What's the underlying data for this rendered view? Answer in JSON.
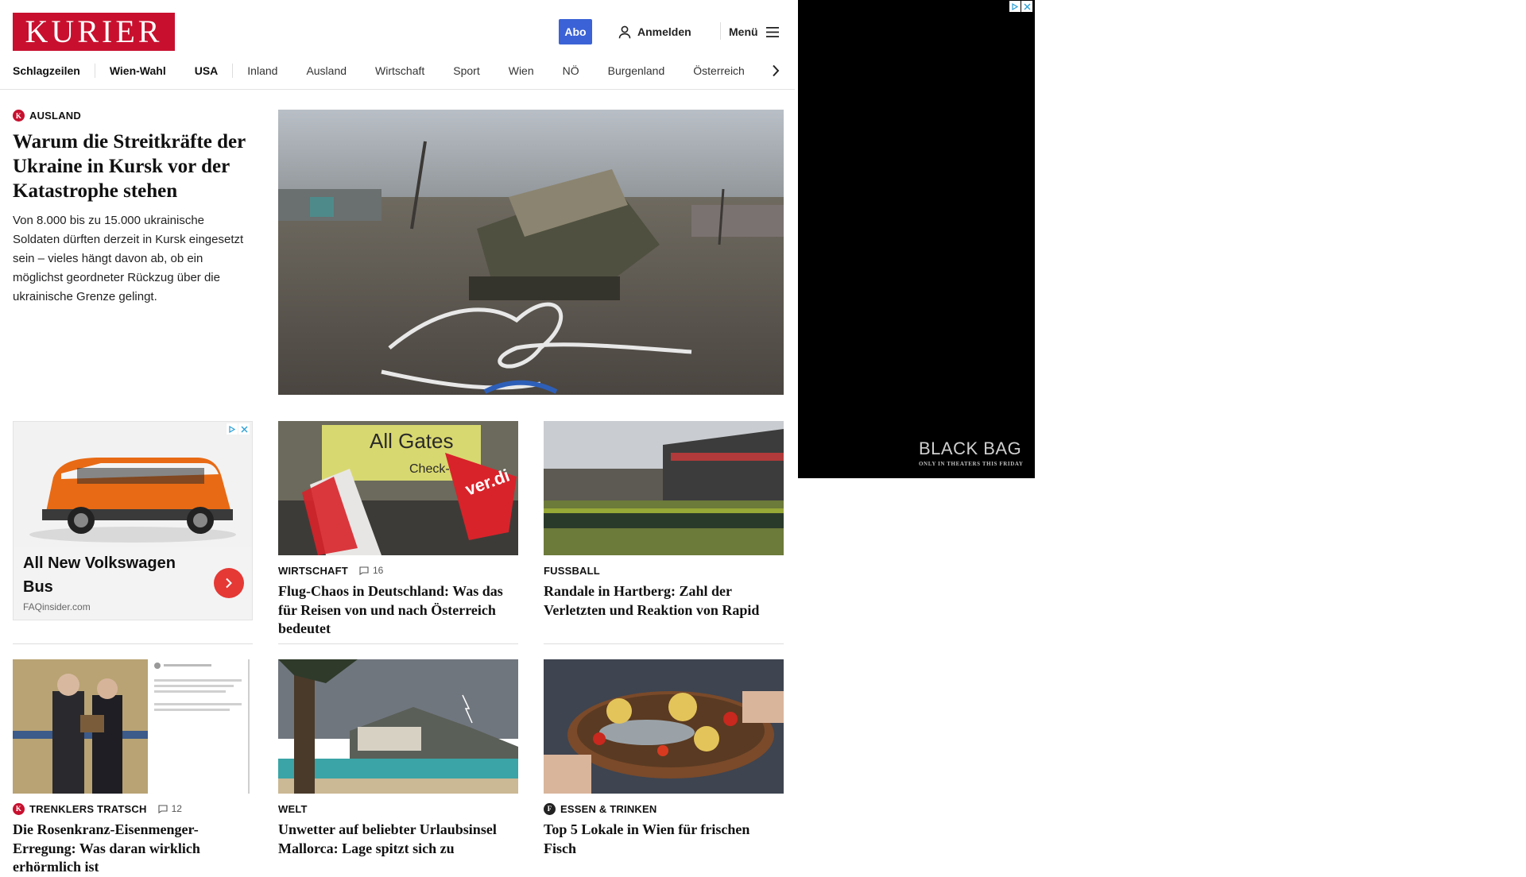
{
  "header": {
    "logo_text": "KURIER",
    "abo_label": "Abo",
    "login_label": "Anmelden",
    "menu_label": "Menü"
  },
  "nav": {
    "items": [
      "Schlagzeilen",
      "Wien-Wahl",
      "USA",
      "Inland",
      "Ausland",
      "Wirtschaft",
      "Sport",
      "Wien",
      "NÖ",
      "Burgenland",
      "Österreich"
    ]
  },
  "lead": {
    "category": "AUSLAND",
    "headline": "Warum die Streitkräfte der Ukraine in Kursk vor der Katastrophe stehen",
    "teaser": "Von 8.000 bis zu 15.000 ukrainische Soldaten dürften derzeit in Kursk eingesetzt sein – vieles hängt davon ab, ob ein möglichst geordneter Rückzug über die ukrainische Grenze gelingt."
  },
  "ad_card": {
    "title": "All New Volkswagen Bus",
    "source": "FAQinsider.com"
  },
  "articles": [
    {
      "category": "WIRTSCHAFT",
      "comments": "16",
      "headline": "Flug-Chaos in Deutschland: Was das für Reisen von und nach Österreich bedeutet",
      "image_text": "All Gates",
      "image_sub": "Check-in",
      "flag_text": "ver.di"
    },
    {
      "category": "FUSSBALL",
      "comments": null,
      "headline": "Randale in Hartberg: Zahl der Verletzten und Reaktion von Rapid"
    },
    {
      "category": "TRENKLERS TRATSCH",
      "comments": "12",
      "headline": "Die Rosenkranz-Eisenmenger-Erregung: Was daran wirklich erhörmlich ist"
    },
    {
      "category": "WELT",
      "comments": null,
      "headline": "Unwetter auf beliebter Urlaubsinsel Mallorca: Lage spitzt sich zu"
    },
    {
      "category": "ESSEN & TRINKEN",
      "comments": null,
      "headline": "Top 5 Lokale in Wien für frischen Fisch"
    }
  ],
  "side_ad": {
    "brand": "BLACK BAG",
    "tagline": "ONLY IN THEATERS THIS FRIDAY"
  },
  "colors": {
    "brand_red": "#c8102e",
    "abo_blue": "#3b62d6",
    "ad_button_red": "#e53935"
  }
}
